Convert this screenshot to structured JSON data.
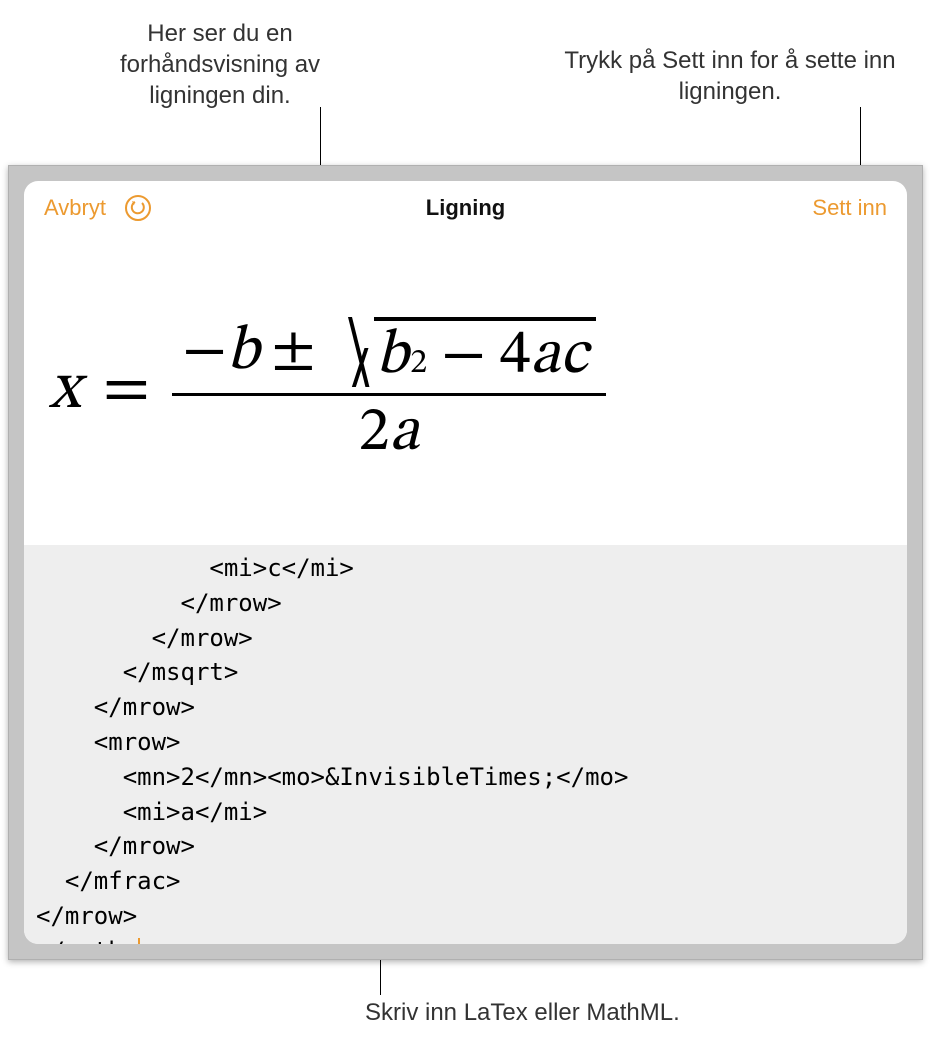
{
  "callouts": {
    "preview": "Her ser du en forhåndsvisning av ligningen din.",
    "insert": "Trykk på Sett inn for å sette inn ligningen.",
    "input": "Skriv inn LaTex eller MathML."
  },
  "toolbar": {
    "cancel": "Avbryt",
    "title": "Ligning",
    "insert": "Sett inn"
  },
  "equation_preview": {
    "lhs": "x",
    "numerator": "−b ± √(b² − 4ac)",
    "denominator": "2a",
    "latex_equivalent": "x = \\frac{-b \\pm \\sqrt{b^{2} - 4ac}}{2a}"
  },
  "code_lines": [
    "            <mi>c</mi>",
    "          </mrow>",
    "        </mrow>",
    "      </msqrt>",
    "    </mrow>",
    "    <mrow>",
    "      <mn>2</mn><mo>&InvisibleTimes;</mo>",
    "      <mi>a</mi>",
    "    </mrow>",
    "  </mfrac>",
    "</mrow>",
    "</math>"
  ]
}
